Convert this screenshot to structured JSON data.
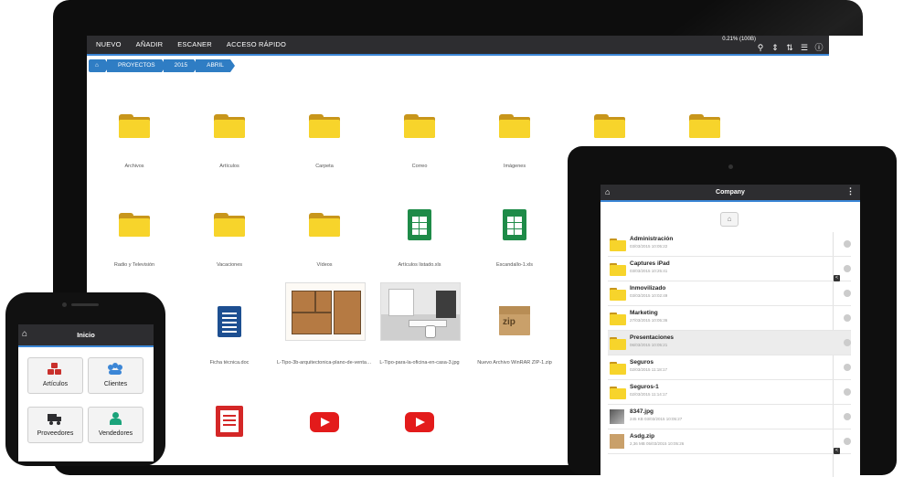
{
  "desktop": {
    "menu": [
      "NUEVO",
      "AÑADIR",
      "ESCANER",
      "ACCESO RÁPIDO"
    ],
    "storage_text": "0.21% (100B)",
    "tools": [
      "search-icon",
      "sort-icon",
      "sort-numeric-icon",
      "list-icon",
      "info-icon"
    ],
    "breadcrumb": [
      "PROYECTOS",
      "2015",
      "ABRIL"
    ],
    "items": [
      {
        "label": "Archivos",
        "type": "folder"
      },
      {
        "label": "Artículos",
        "type": "folder"
      },
      {
        "label": "Carpeta",
        "type": "folder"
      },
      {
        "label": "Correo",
        "type": "folder"
      },
      {
        "label": "Imágenes",
        "type": "folder"
      },
      {
        "label": "",
        "type": "folder"
      },
      {
        "label": "",
        "type": "folder"
      },
      {
        "label": "Radio y Televisión",
        "type": "folder"
      },
      {
        "label": "Vacaciones",
        "type": "folder"
      },
      {
        "label": "Vídeos",
        "type": "folder"
      },
      {
        "label": "Artículos listado.xls",
        "type": "spreadsheet"
      },
      {
        "label": "Escandallo-1.xls",
        "type": "spreadsheet"
      },
      {
        "label": "Ficha técnica.doc",
        "type": "document"
      },
      {
        "label": "L-Tipo-3b-arquitectonica-plano-de-ventas-...",
        "type": "image-plan"
      },
      {
        "label": "L-Tipo-para-la-oficina-en-casa-3.jpg",
        "type": "image-office"
      },
      {
        "label": "Nuevo Archivo WinRAR ZIP-1.zip",
        "type": "zip"
      },
      {
        "label": "",
        "type": "pdf"
      },
      {
        "label": "",
        "type": "video"
      },
      {
        "label": "",
        "type": "video"
      }
    ]
  },
  "tablet": {
    "title": "Company",
    "files": [
      {
        "name": "Administración",
        "meta": "03/03/2015 10:05:22",
        "type": "folder"
      },
      {
        "name": "Captures iPad",
        "meta": "03/03/2015 10:25:41",
        "type": "folder",
        "shared": true
      },
      {
        "name": "Inmovilizado",
        "meta": "03/03/2015 10:02:49",
        "type": "folder"
      },
      {
        "name": "Marketing",
        "meta": "27/03/2015 10:05:36",
        "type": "folder"
      },
      {
        "name": "Presentaciones",
        "meta": "06/03/2015 10:05:21",
        "type": "folder",
        "selected": true
      },
      {
        "name": "Seguros",
        "meta": "02/03/2015 11:18:17",
        "type": "folder"
      },
      {
        "name": "Seguros-1",
        "meta": "02/03/2015 11:14:17",
        "type": "folder"
      },
      {
        "name": "8347.jpg",
        "meta": "245 KB\n03/03/2015 10:05:27",
        "type": "image"
      },
      {
        "name": "Asdg.zip",
        "meta": "2,36 MB\n05/03/2015 10:05:26",
        "type": "zip",
        "shared": true
      }
    ]
  },
  "phone": {
    "title": "Inicio",
    "buttons": [
      {
        "label": "Artículos",
        "icon": "cubes-icon"
      },
      {
        "label": "Clientes",
        "icon": "users-icon"
      },
      {
        "label": "Proveedores",
        "icon": "truck-icon"
      },
      {
        "label": "Vendedores",
        "icon": "seller-icon"
      }
    ]
  },
  "colors": {
    "accent": "#3b86d6",
    "bar": "#2d2d30",
    "folder": "#f7d42b",
    "excel": "#1e8b48",
    "word": "#1d4f91",
    "pdf": "#d42727"
  }
}
